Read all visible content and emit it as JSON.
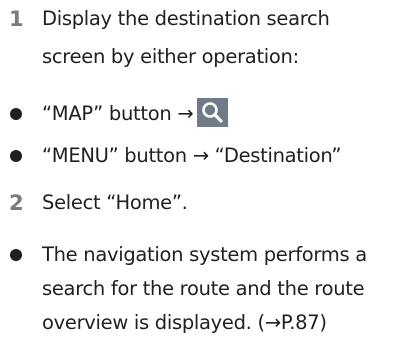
{
  "steps": [
    {
      "number": "1",
      "lines": [
        "Display the destination search",
        "screen by either operation:"
      ]
    },
    {
      "number": "2",
      "lines": [
        "Select “Home”."
      ]
    }
  ],
  "operations": [
    {
      "text": "“MAP” button →",
      "icon": "search-icon"
    },
    {
      "text": "“MENU” button → “Destination”"
    }
  ],
  "note": {
    "lines": [
      "The navigation system performs a",
      "search for the route and the route",
      "overview is displayed. (→P.87)"
    ]
  },
  "colors": {
    "step_number": "#7a7a7a",
    "icon_background": "#6f7b86",
    "text": "#1f1f1f"
  }
}
